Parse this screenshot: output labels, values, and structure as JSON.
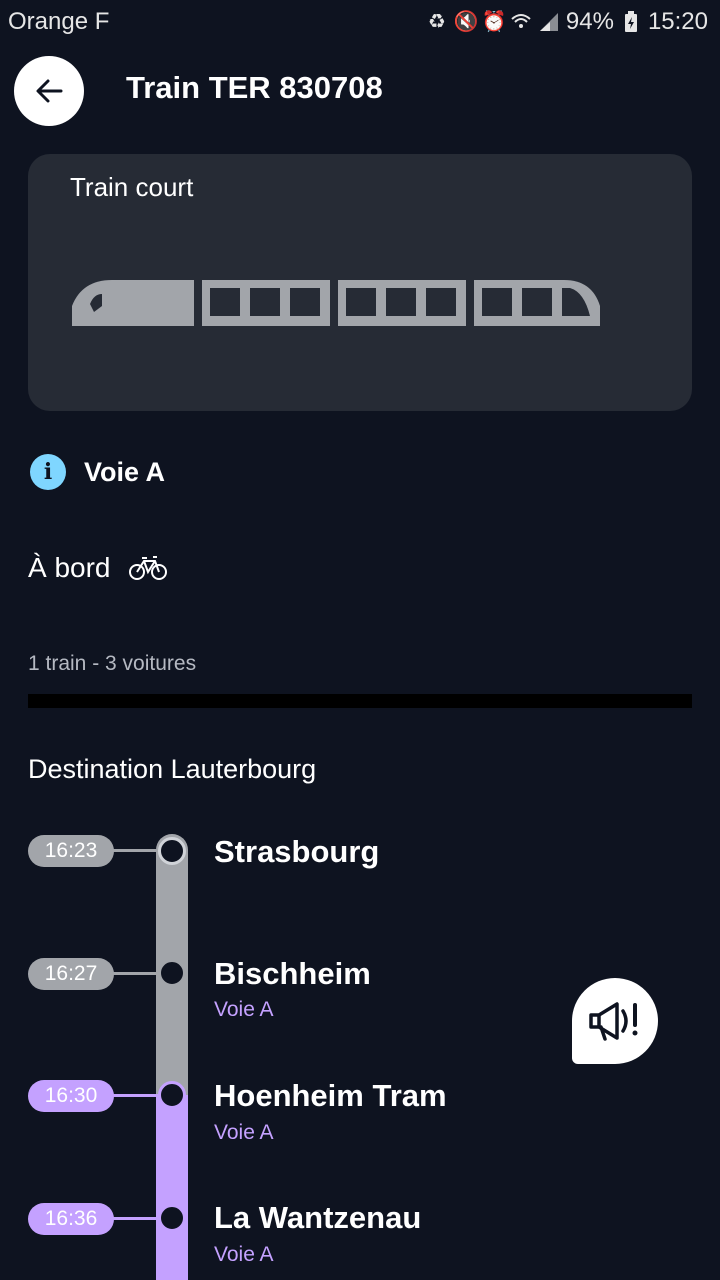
{
  "status_bar": {
    "carrier": "Orange F",
    "battery": "94%",
    "time": "15:20"
  },
  "header": {
    "title": "Train TER 830708"
  },
  "train_card": {
    "label": "Train court"
  },
  "info": {
    "platform": "Voie A"
  },
  "onboard": {
    "label": "À bord"
  },
  "composition": "1 train - 3 voitures",
  "destination": "Destination Lauterbourg",
  "stops": [
    {
      "time": "16:23",
      "name": "Strasbourg",
      "platform": ""
    },
    {
      "time": "16:27",
      "name": "Bischheim",
      "platform": "Voie A"
    },
    {
      "time": "16:30",
      "name": "Hoenheim Tram",
      "platform": "Voie A"
    },
    {
      "time": "16:36",
      "name": "La Wantzenau",
      "platform": "Voie A"
    }
  ],
  "colors": {
    "background": "#0e1320",
    "card": "#262b35",
    "accent_purple": "#c4a1ff",
    "rail_grey": "#a2a5aa",
    "info_blue": "#7fd6ff"
  }
}
